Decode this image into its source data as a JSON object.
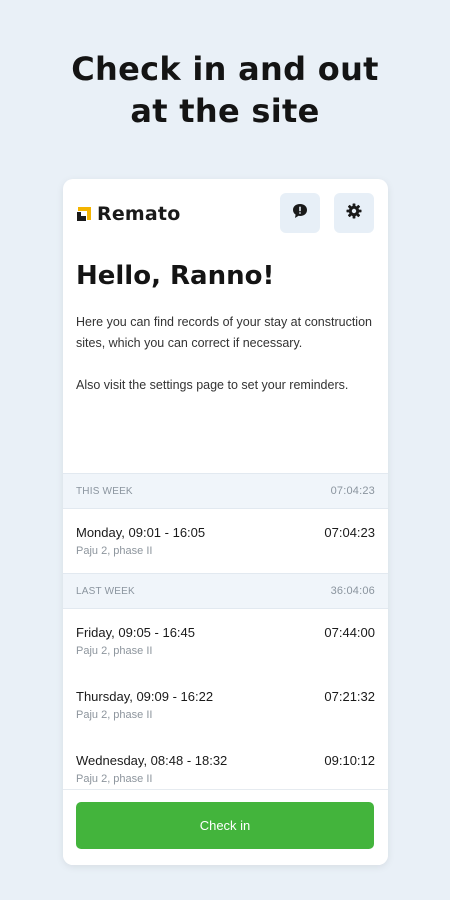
{
  "headline": {
    "line1": "Check in and out",
    "line2": "at the site"
  },
  "app": {
    "brand": "Remato",
    "brand_color": "#f4b400",
    "chat_icon": "chat-bubble-exclamation-icon",
    "settings_icon": "gear-icon"
  },
  "greeting": "Hello, Ranno!",
  "intro": {
    "p1": "Here you can find records of your stay at construction sites, which you can correct if necessary.",
    "p2": "Also visit the settings page to set your reminders."
  },
  "this_week": {
    "label": "THIS WEEK",
    "total": "07:04:23",
    "entries": [
      {
        "title": "Monday, 09:01 - 16:05",
        "site": "Paju 2, phase II",
        "duration": "07:04:23"
      }
    ]
  },
  "last_week": {
    "label": "LAST WEEK",
    "total": "36:04:06",
    "entries": [
      {
        "title": "Friday, 09:05 - 16:45",
        "site": "Paju 2, phase II",
        "duration": "07:44:00"
      },
      {
        "title": "Thursday, 09:09 - 16:22",
        "site": "Paju 2, phase II",
        "duration": "07:21:32"
      },
      {
        "title": "Wednesday, 08:48 - 18:32",
        "site": "Paju 2, phase II",
        "duration": "09:10:12"
      }
    ]
  },
  "footer": {
    "checkin_label": "Check in",
    "accent_color": "#43b43c"
  }
}
